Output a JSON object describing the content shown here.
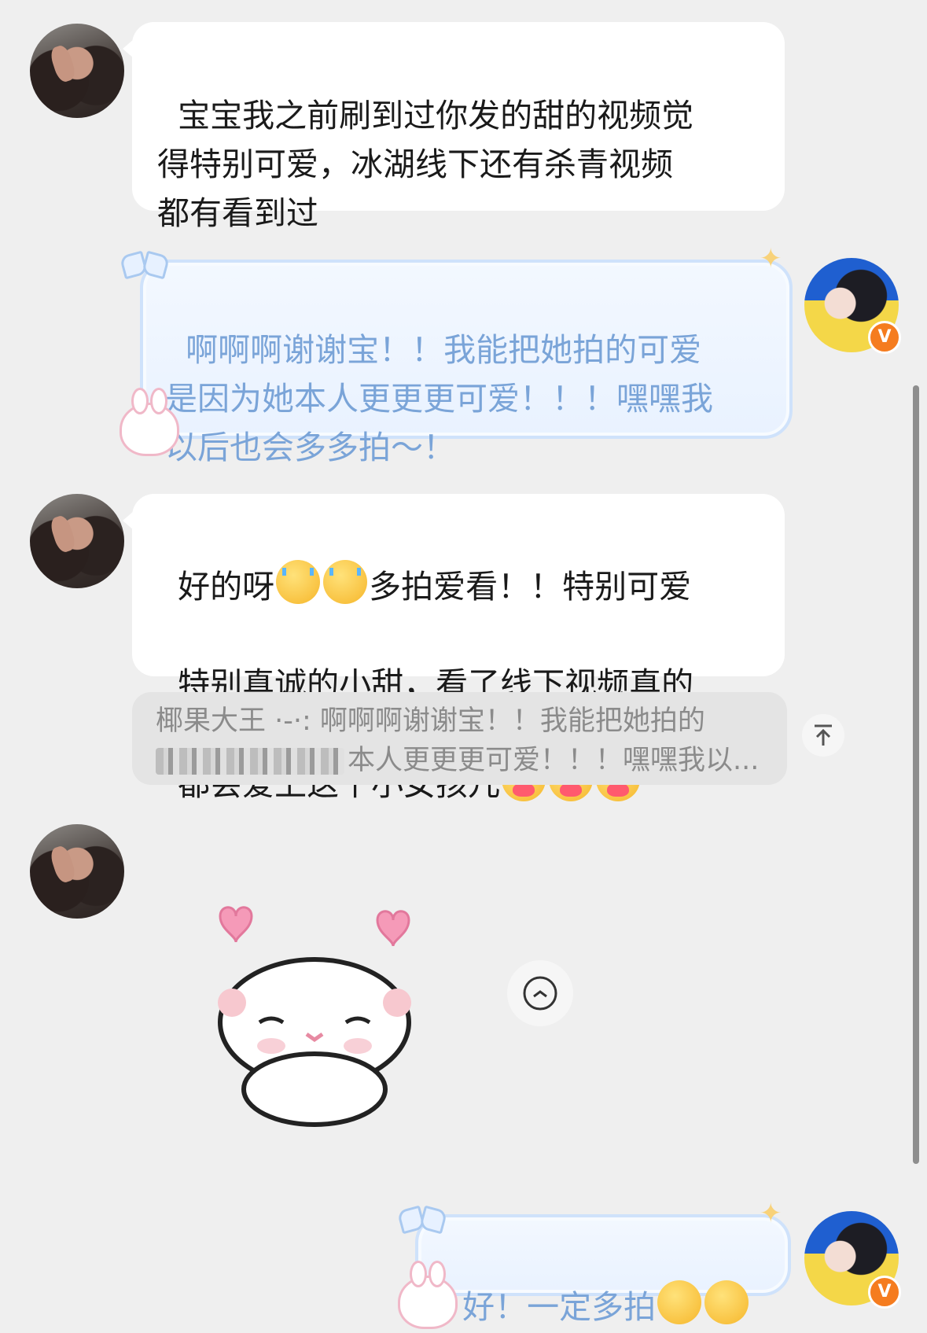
{
  "messages": [
    {
      "side": "left",
      "type": "text",
      "text": "宝宝我之前刷到过你发的甜的视频觉\n得特别可爱，冰湖线下还有杀青视频\n都有看到过"
    },
    {
      "side": "right",
      "type": "text",
      "text": "啊啊啊谢谢宝！！我能把她拍的可爱\n是因为她本人更更更可爱！！！嘿嘿我\n以后也会多多拍～！"
    },
    {
      "side": "left",
      "type": "text",
      "line1_a": "好的呀",
      "line1_b": "多拍爱看！！特别可爱",
      "line2": "特别真诚的小甜，看了线下视频真的",
      "line3": "都会爱上这个小女孩儿"
    },
    {
      "side": "left",
      "type": "quote",
      "line1": "椰果大王 ·-·: 啊啊啊谢谢宝！！我能把她拍的",
      "line2": "本人更更更可爱！！！嘿嘿我以..."
    },
    {
      "side": "left",
      "type": "sticker"
    },
    {
      "side": "right",
      "type": "text",
      "text": "好！一定多拍"
    }
  ],
  "icons": {
    "top_button": "arrow-to-top-icon",
    "reply_button": "undo-icon",
    "verified_badge": "V"
  },
  "colors": {
    "background": "#efefef",
    "bubble": "#ffffff",
    "my_bubble_text": "#7aa4d8",
    "verified": "#f57c1f"
  }
}
